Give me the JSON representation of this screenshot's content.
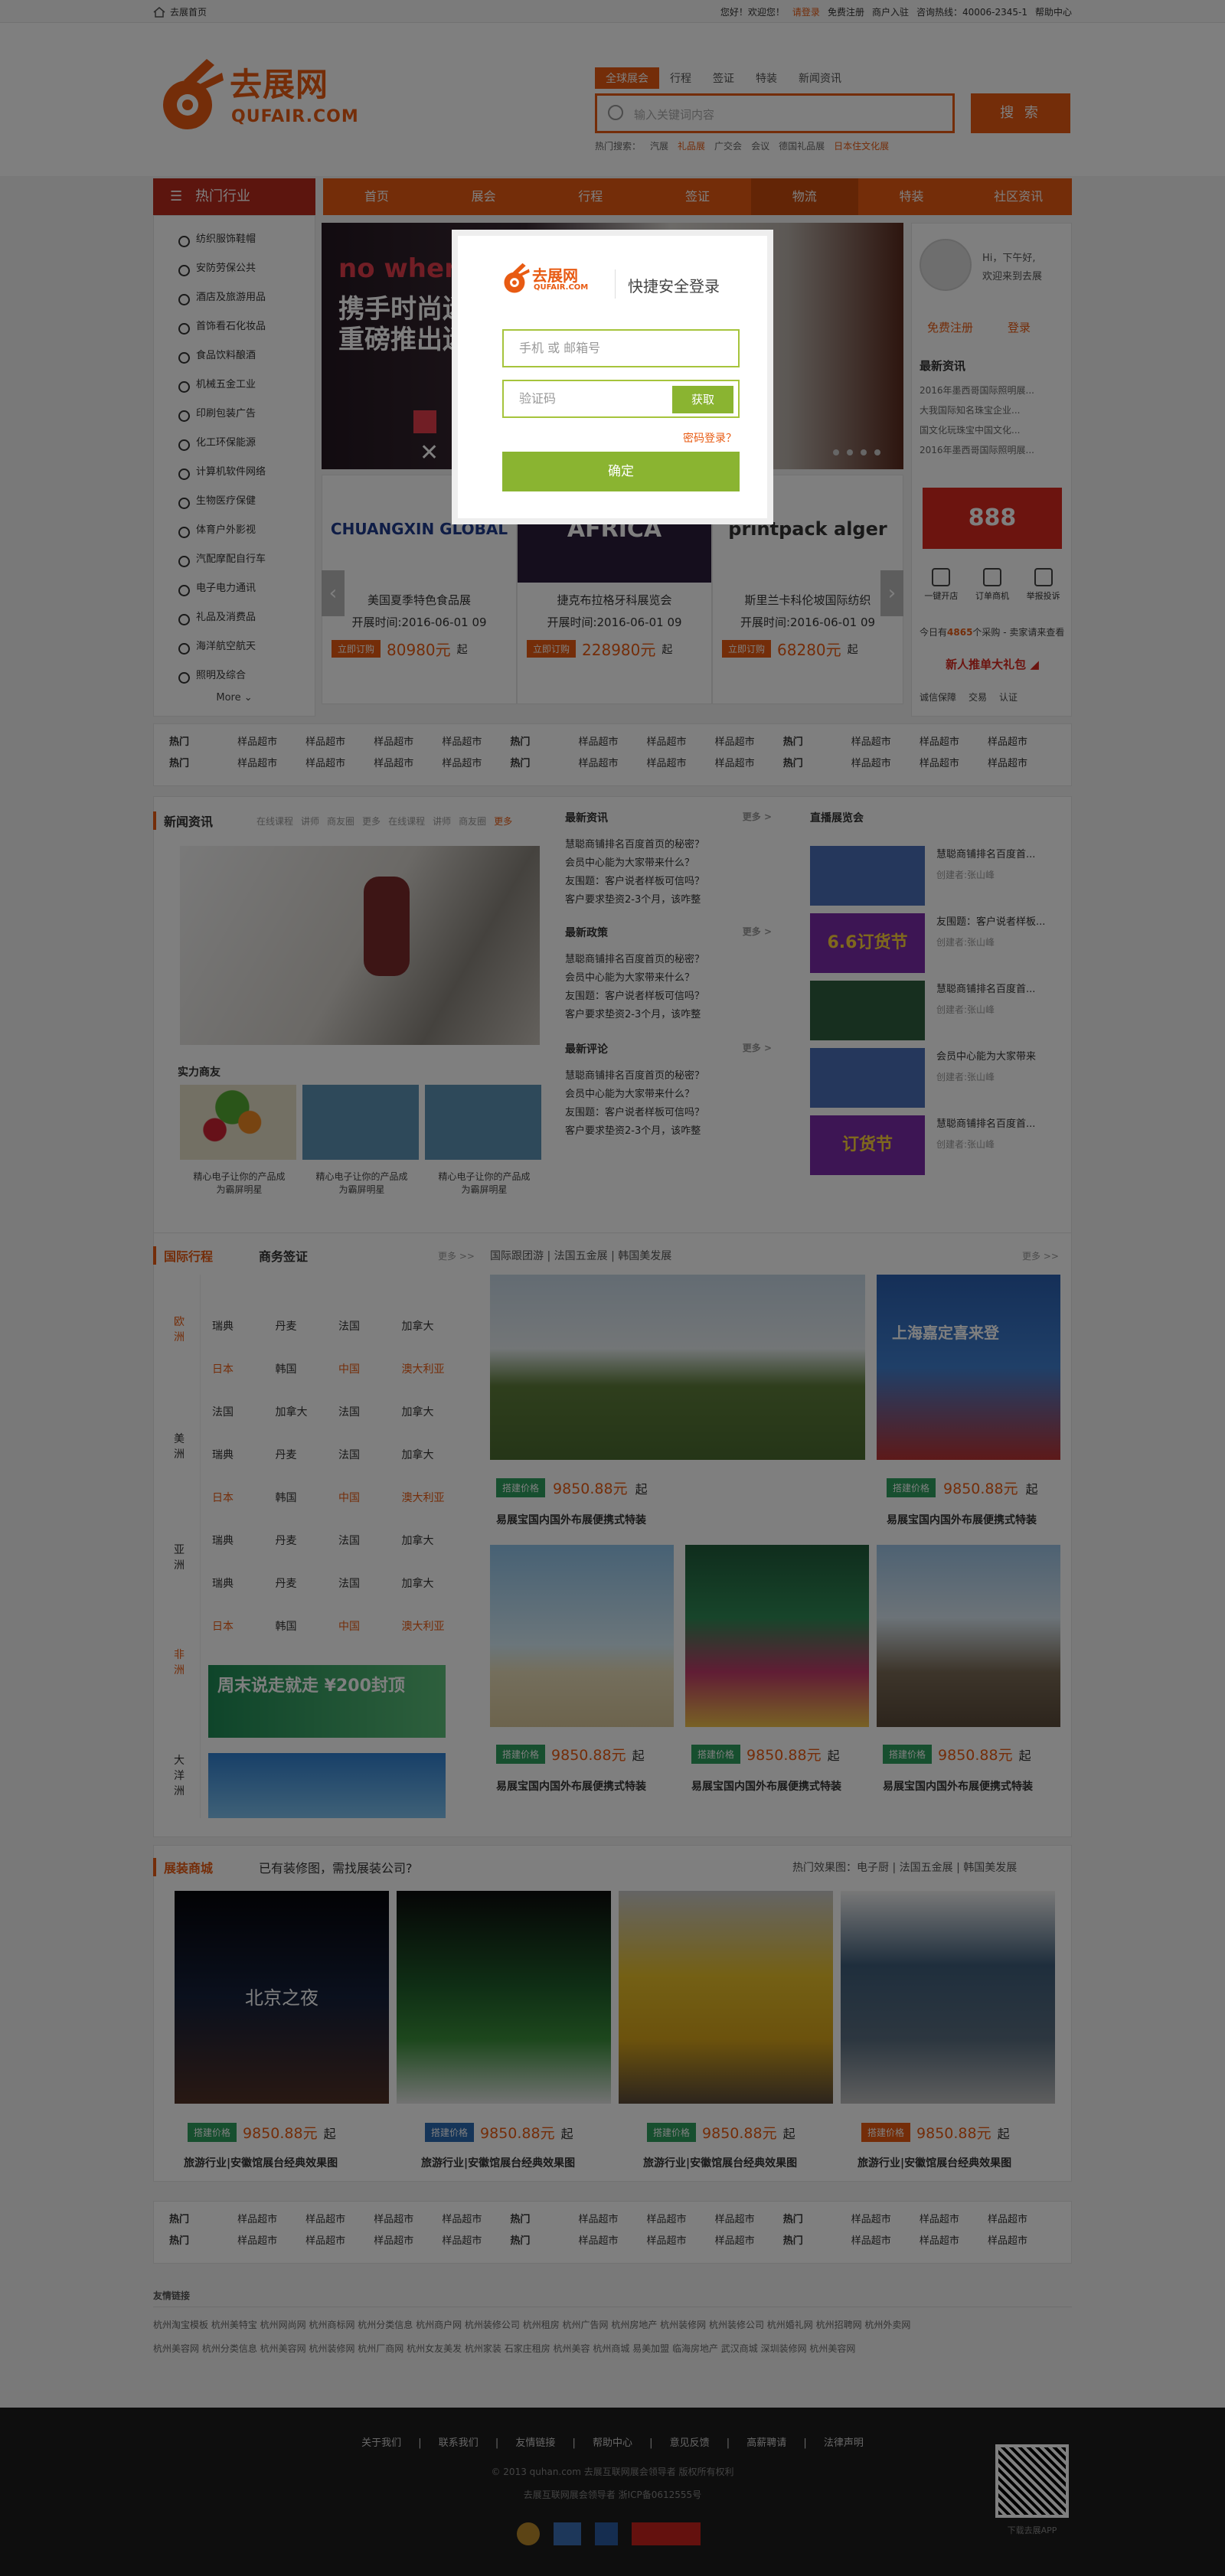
{
  "topbar": {
    "home": "去展首页",
    "welcome": "您好！欢迎您！",
    "login": "请登录",
    "register": "免费注册",
    "merchant": "商户入驻",
    "hotline": "咨询热线：40006-2345-1",
    "help": "帮助中心"
  },
  "logo": {
    "cn": "去展网",
    "en": "QUFAIR.COM"
  },
  "search": {
    "tabs": [
      "全球展会",
      "行程",
      "签证",
      "特装",
      "新闻资讯"
    ],
    "placeholder": "输入关键词内容",
    "button": "搜 索",
    "hot_label": "热门搜索：",
    "hot": [
      "汽展",
      "礼品展",
      "广交会",
      "会议",
      "德国礼品展",
      "日本住文化展"
    ]
  },
  "nav": {
    "category": "热门行业",
    "items": [
      "首页",
      "展会",
      "行程",
      "签证",
      "物流",
      "特装",
      "社区资讯"
    ]
  },
  "sidebar": {
    "items": [
      "纺织服饰鞋帽",
      "安防劳保公共",
      "酒店及旅游用品",
      "首饰看石化妆品",
      "食品饮料酿酒",
      "机械五金工业",
      "印刷包装广告",
      "化工环保能源",
      "计算机软件网络",
      "生物医疗保健",
      "体育户外影视",
      "汽配摩配自行车",
      "电子电力通讯",
      "礼品及消费品",
      "海洋航空航天",
      "照明及综合"
    ],
    "more": "More"
  },
  "banner": {
    "line1": "no where",
    "line2": "携手时尚迷",
    "line3": "重磅推出迷"
  },
  "exhibitors": [
    {
      "logo": "CHUANGXIN GLOBAL",
      "name": "美国夏季特色食品展",
      "date": "开展时间:2016-06-01 09",
      "price": "80980元",
      "from": "起",
      "btn": "立即订购"
    },
    {
      "logo": "AFRICA",
      "name": "捷克布拉格牙科展览会",
      "date": "开展时间:2016-06-01 09",
      "price": "228980元",
      "from": "起",
      "btn": "立即订购"
    },
    {
      "logo": "printpack alger",
      "name": "斯里兰卡科伦坡国际纺织",
      "date": "开展时间:2016-06-01 09",
      "price": "68280元",
      "from": "起",
      "btn": "立即订购"
    }
  ],
  "right_panel": {
    "greeting1": "Hi，下午好,",
    "greeting2": "欢迎来到去展",
    "register": "免费注册",
    "login": "登录",
    "news_title": "最新资讯",
    "news": [
      "2016年墨西哥国际照明展...",
      "大我国际知名珠宝企业...",
      "国文化玩珠宝中国文化...",
      "2016年墨西哥国际照明展..."
    ],
    "promo": "888",
    "tools": [
      "一键开店",
      "订单商机",
      "举报投诉"
    ],
    "biz_text": "今日有",
    "biz_count": "4865",
    "biz_text2": "个采购 - 卖家请来查看",
    "gift": "新人推单大礼包",
    "security": [
      "诚信保障",
      "交易",
      "认证"
    ]
  },
  "hot_rows": [
    [
      "热门",
      "样品超市",
      "样品超市",
      "样品超市",
      "样品超市",
      "热门",
      "样品超市",
      "样品超市",
      "样品超市",
      "热门",
      "样品超市",
      "样品超市",
      "样品超市"
    ],
    [
      "热门",
      "样品超市",
      "样品超市",
      "样品超市",
      "样品超市",
      "热门",
      "样品超市",
      "样品超市",
      "样品超市",
      "热门",
      "样品超市",
      "样品超市",
      "样品超市"
    ]
  ],
  "news": {
    "title": "新闻资讯",
    "tabs": [
      "在线课程",
      "讲师",
      "商友圈",
      "更多",
      "在线课程",
      "讲师",
      "商友圈",
      "更多"
    ],
    "partners_title": "实力商友",
    "partner_caption": "精心电子让你的产品成为霸屏明星",
    "col2": [
      {
        "title": "最新资讯",
        "more": "更多 >",
        "items": [
          "慧聪商铺排名百度首页的秘密？",
          "会员中心能为大家带来什么？",
          "友围题：客户说者样板可信吗？",
          "客户要求垫资2-3个月，该咋整"
        ]
      },
      {
        "title": "最新政策",
        "more": "更多 >",
        "items": [
          "慧聪商铺排名百度首页的秘密？",
          "会员中心能为大家带来什么？",
          "友围题：客户说者样板可信吗？",
          "客户要求垫资2-3个月，该咋整"
        ]
      },
      {
        "title": "最新评论",
        "more": "更多 >",
        "items": [
          "慧聪商铺排名百度首页的秘密？",
          "会员中心能为大家带来什么？",
          "友围题：客户说者样板可信吗？",
          "客户要求垫资2-3个月，该咋整"
        ]
      }
    ],
    "col3_title": "直播展览会",
    "col3": [
      {
        "t": "慧聪商铺排名百度首...",
        "a": "创建者:张山峰",
        "img": "6.6订货节"
      },
      {
        "t": "友围题：客户说者样板...",
        "a": "创建者:张山峰",
        "img": "6.6订货节"
      },
      {
        "t": "慧聪商铺排名百度首...",
        "a": "创建者:张山峰",
        "img": ""
      },
      {
        "t": "会员中心能为大家带来",
        "a": "创建者:张山峰",
        "img": ""
      },
      {
        "t": "慧聪商铺排名百度首...",
        "a": "创建者:张山峰",
        "img": "订货节"
      }
    ]
  },
  "intl": {
    "title": "国际行程",
    "tab2": "商务签证",
    "more": "更多 >>",
    "tags": "国际跟团游 | 法国五金展 | 韩国美发展",
    "more2": "更多 >>",
    "regions": [
      "欧洲",
      "美洲",
      "亚洲",
      "非洲",
      "大洋洲"
    ],
    "countries": [
      [
        "瑞典",
        "丹麦",
        "法国",
        "加拿大"
      ],
      [
        "日本",
        "韩国",
        "中国",
        "澳大利亚"
      ],
      [
        "法国",
        "加拿大",
        "法国",
        "加拿大"
      ],
      [
        "瑞典",
        "丹麦",
        "法国",
        "加拿大"
      ],
      [
        "日本",
        "韩国",
        "中国",
        "澳大利亚"
      ],
      [
        "瑞典",
        "丹麦",
        "法国",
        "加拿大"
      ],
      [
        "瑞典",
        "丹麦",
        "法国",
        "加拿大"
      ],
      [
        "日本",
        "韩国",
        "中国",
        "澳大利亚"
      ]
    ],
    "ad1": "周末说走就走 ¥200封顶",
    "items": [
      {
        "badge": "搭建价格",
        "price": "9850.88元",
        "from": "起",
        "title": "易展宝国内国外布展便携式特装"
      },
      {
        "badge": "搭建价格",
        "price": "9850.88元",
        "from": "起",
        "title": "易展宝国内国外布展便携式特装"
      },
      {
        "badge": "搭建价格",
        "price": "9850.88元",
        "from": "起",
        "title": "易展宝国内国外布展便携式特装"
      },
      {
        "badge": "搭建价格",
        "price": "9850.88元",
        "from": "起",
        "title": "易展宝国内国外布展便携式特装"
      },
      {
        "badge": "搭建价格",
        "price": "9850.88元",
        "from": "起",
        "title": "易展宝国内国外布展便携式特装"
      }
    ],
    "img2_text": "上海嘉定喜来登"
  },
  "mall": {
    "title": "展装商城",
    "sub": "已有装修图，需找展装公司?",
    "hot": "热门效果图：电子厨 | 法国五金展 | 韩国美发展",
    "items": [
      {
        "badge": "搭建价格",
        "price": "9850.88元",
        "from": "起",
        "title": "旅游行业|安徽馆展台经典效果图",
        "img": "北京之夜"
      },
      {
        "badge": "搭建价格",
        "price": "9850.88元",
        "from": "起",
        "title": "旅游行业|安徽馆展台经典效果图",
        "img": ""
      },
      {
        "badge": "搭建价格",
        "price": "9850.88元",
        "from": "起",
        "title": "旅游行业|安徽馆展台经典效果图",
        "img": ""
      },
      {
        "badge": "搭建价格",
        "price": "9850.88元",
        "from": "起",
        "title": "旅游行业|安徽馆展台经典效果图",
        "img": ""
      }
    ]
  },
  "friends": {
    "title": "友情链接",
    "row1": "杭州淘宝模板  杭州美特宝  杭州网尚网  杭州商标网  杭州分类信息  杭州商户网  杭州装修公司  杭州租房  杭州广告网  杭州房地产  杭州装修网  杭州装修公司  杭州婚礼网  杭州招聘网  杭州外卖网",
    "row2": "杭州美容网  杭州分类信息  杭州美容网  杭州装修网  杭州厂商网  杭州女友美发  杭州家装  石家庄租房  杭州美容  杭州商城  易美加盟  临海房地产  武汉商城  深圳装修网  杭州美容网"
  },
  "footer": {
    "links": "关于我们 | 联系我们 | 友情链接 | 帮助中心 | 意见反馈 | 高薪聘请 | 法律声明",
    "copyright": "© 2013 quhan.com 去展互联网展会领导者 版权所有权利",
    "icp": "去展互联网展会领导者 浙ICP备0612555号",
    "qr_text": "下载去展APP"
  },
  "modal": {
    "logo_cn": "去展网",
    "logo_en": "QUFAIR.COM",
    "title": "快捷安全登录",
    "phone_placeholder": "手机 或 邮箱号",
    "code_placeholder": "验证码",
    "get_code": "获取",
    "forgot": "密码登录？",
    "confirm": "确定"
  }
}
